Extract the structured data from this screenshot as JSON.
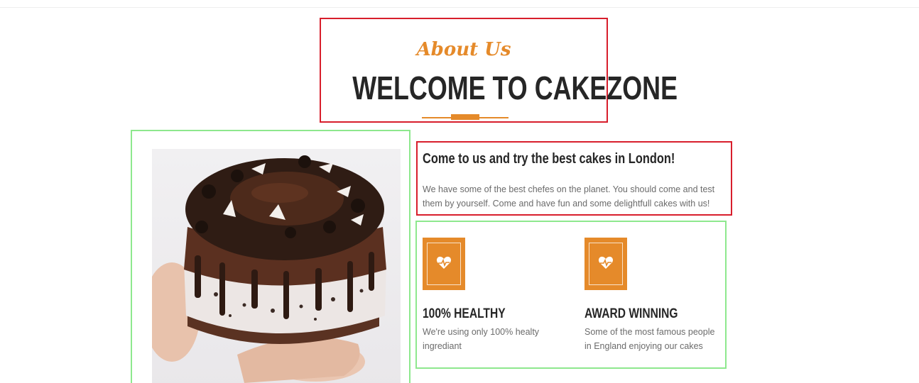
{
  "header": {
    "kicker": "About Us",
    "title": "WELCOME TO CAKEZONE"
  },
  "intro": {
    "heading": "Come to us and try the best cakes in London!",
    "text": "We have some of the best chefes on the planet. You should come and test them by yourself. Come and have fun and some delightfull cakes with us!"
  },
  "features": [
    {
      "icon": "heart-pulse-icon",
      "title": "100% HEALTHY",
      "description": "We're using only 100% healty ingrediant"
    },
    {
      "icon": "heart-pulse-icon",
      "title": "AWARD WINNING",
      "description": "Some of the most famous people in England enjoying our cakes"
    }
  ],
  "colors": {
    "accent": "#e58a2a",
    "heading": "#262626",
    "body_text": "#6b6b6b",
    "red_outline": "#d81e2c",
    "green_outline": "#8ee88e"
  }
}
